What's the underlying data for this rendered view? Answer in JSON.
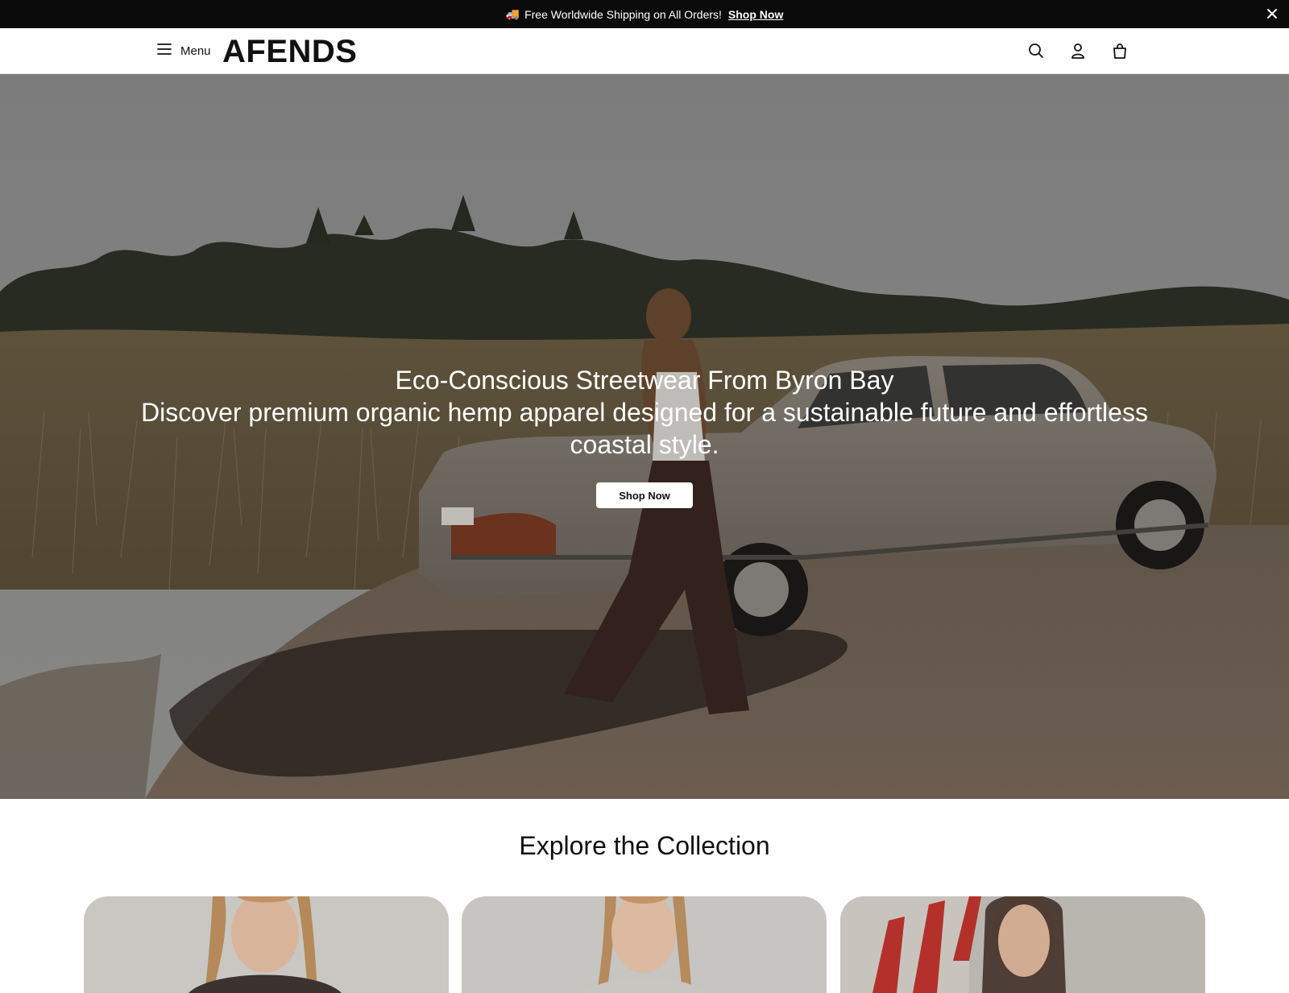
{
  "announcement": {
    "emoji": "🚚",
    "message": "Free Worldwide Shipping on All Orders!",
    "link_label": "Shop Now"
  },
  "header": {
    "menu_label": "Menu",
    "logo": "AFENDS",
    "icons": [
      "search-icon",
      "account-icon",
      "bag-icon"
    ]
  },
  "hero": {
    "title": "Eco-Conscious Streetwear From Byron Bay",
    "subtitle": "Discover premium organic hemp apparel designed for a sustainable future and effortless coastal style.",
    "button_label": "Shop Now"
  },
  "collection": {
    "title": "Explore the Collection"
  },
  "colors": {
    "announcement_bg": "#0b0b0b",
    "text": "#111111",
    "background": "#ffffff"
  }
}
